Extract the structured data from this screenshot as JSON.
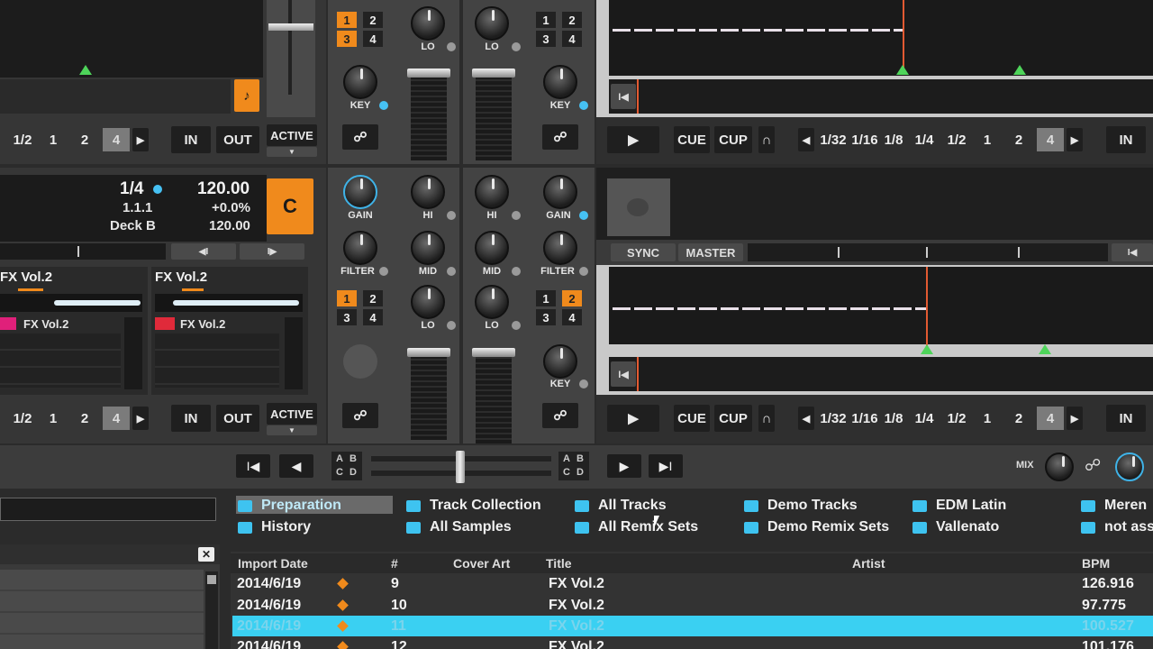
{
  "deck_a": {
    "loop_sizes": [
      "1/2",
      "1",
      "2",
      "4"
    ],
    "in": "IN",
    "out": "OUT",
    "active": "ACTIVE"
  },
  "deck_b": {
    "loop_size": "1/4",
    "position": "1.1.1",
    "name": "Deck B",
    "bpm": "120.00",
    "tempo": "+0.0%",
    "bpm2": "120.00",
    "letter": "C",
    "loop_sizes": [
      "1/2",
      "1",
      "2",
      "4"
    ],
    "in": "IN",
    "out": "OUT",
    "active": "ACTIVE",
    "slots": [
      {
        "title": "FX Vol.2",
        "sample": "FX Vol.2",
        "color": "#e0207a"
      },
      {
        "title": "FX Vol.2",
        "sample": "FX Vol.2",
        "color": "#e02a3a"
      }
    ]
  },
  "mixer": {
    "cue_labels": [
      "1",
      "2",
      "3",
      "4"
    ],
    "knobs": {
      "gain": "GAIN",
      "hi": "HI",
      "mid": "MID",
      "lo": "LO",
      "filter": "FILTER",
      "key": "KEY"
    }
  },
  "deck_right_top": {
    "cue": "CUE",
    "cup": "CUP",
    "loop_sizes": [
      "1/32",
      "1/16",
      "1/8",
      "1/4",
      "1/2",
      "1",
      "2",
      "4"
    ],
    "in": "IN"
  },
  "deck_right_bottom": {
    "sync": "SYNC",
    "master": "MASTER",
    "cue": "CUE",
    "cup": "CUP",
    "loop_sizes": [
      "1/32",
      "1/16",
      "1/8",
      "1/4",
      "1/2",
      "1",
      "2",
      "4"
    ],
    "in": "IN"
  },
  "transport": {
    "ab_top": [
      "A",
      "B"
    ],
    "ab_bottom": [
      "C",
      "D"
    ],
    "mix": "MIX"
  },
  "favorites": [
    {
      "label": "Preparation",
      "color": "#3ec3f0"
    },
    {
      "label": "Track Collection",
      "color": "#3ec3f0"
    },
    {
      "label": "All Tracks",
      "color": "#3ec3f0"
    },
    {
      "label": "Demo Tracks",
      "color": "#3ec3f0"
    },
    {
      "label": "EDM Latin",
      "color": "#3ec3f0"
    },
    {
      "label": "Meren",
      "color": "#3ec3f0"
    },
    {
      "label": "History",
      "color": "#3ec3f0"
    },
    {
      "label": "All Samples",
      "color": "#3ec3f0"
    },
    {
      "label": "All Remix Sets",
      "color": "#3ec3f0"
    },
    {
      "label": "Demo Remix Sets",
      "color": "#3ec3f0"
    },
    {
      "label": "Vallenato",
      "color": "#3ec3f0"
    },
    {
      "label": "not ass",
      "color": "#3ec3f0"
    }
  ],
  "table": {
    "headers": {
      "import_date": "Import Date",
      "num": "#",
      "cover_art": "Cover Art",
      "title": "Title",
      "artist": "Artist",
      "bpm": "BPM"
    },
    "rows": [
      {
        "date": "2014/6/19",
        "num": "9",
        "title": "FX Vol.2",
        "bpm": "126.916"
      },
      {
        "date": "2014/6/19",
        "num": "10",
        "title": "FX Vol.2",
        "bpm": "97.775"
      },
      {
        "date": "2014/6/19",
        "num": "11",
        "title": "FX Vol.2",
        "bpm": "100.527"
      },
      {
        "date": "2014/6/19",
        "num": "12",
        "title": "FX Vol.2",
        "bpm": "101.176"
      }
    ]
  },
  "colors": {
    "accent": "#f08a1c",
    "blue": "#3ec3f0",
    "playhead": "#e25a32",
    "marker": "#4ed45a"
  }
}
